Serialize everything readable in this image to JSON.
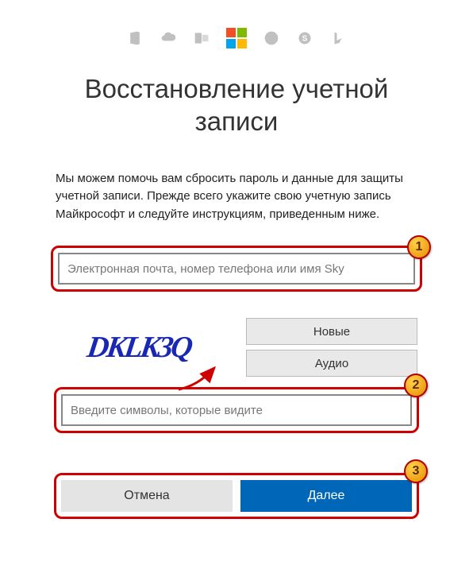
{
  "header": {
    "title": "Восстановление учетной записи"
  },
  "description": "Мы можем помочь вам сбросить пароль и данные для защиты учетной записи. Прежде всего укажите свою учетную запись Майкрософт и следуйте инструкциям, приведенным ниже.",
  "account_input": {
    "placeholder": "Электронная почта, номер телефона или имя Sky",
    "value": ""
  },
  "captcha": {
    "image_text": "DKLK3Q",
    "new_label": "Новые",
    "audio_label": "Аудио",
    "input_placeholder": "Введите символы, которые видите",
    "input_value": ""
  },
  "actions": {
    "cancel": "Отмена",
    "next": "Далее"
  },
  "badges": {
    "one": "1",
    "two": "2",
    "three": "3"
  },
  "icons": [
    "office",
    "onedrive",
    "outlook",
    "microsoft",
    "xbox",
    "skype",
    "bing"
  ],
  "colors": {
    "accent": "#0067b8",
    "highlight": "#cf0000"
  }
}
